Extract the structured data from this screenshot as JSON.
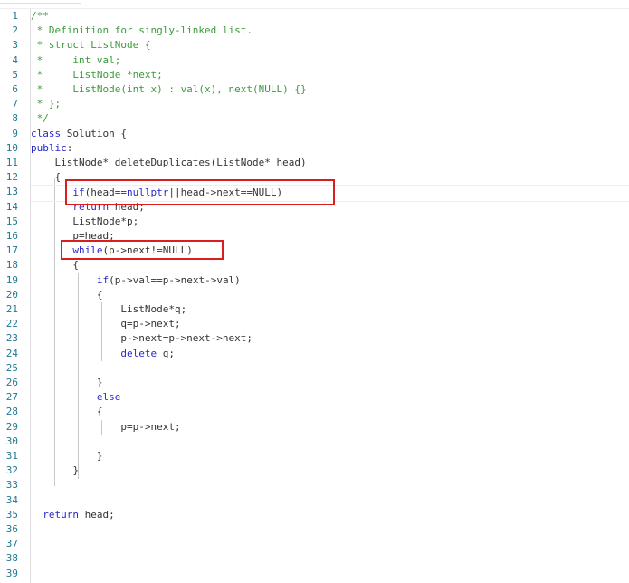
{
  "editor": {
    "current_line": 13,
    "colors": {
      "comment": "#3c9a3c",
      "keyword": "#2828c8",
      "text": "#333333",
      "line_number": "#237893",
      "highlight_box": "#d81e1e"
    },
    "highlighted_lines": [
      13,
      17
    ],
    "lines": [
      [
        [
          "/**",
          "c"
        ]
      ],
      [
        [
          " * Definition for singly-linked list.",
          "c"
        ]
      ],
      [
        [
          " * struct ListNode {",
          "c"
        ]
      ],
      [
        [
          " *     int val;",
          "c"
        ]
      ],
      [
        [
          " *     ListNode *next;",
          "c"
        ]
      ],
      [
        [
          " *     ListNode(int x) : val(x), next(NULL) {}",
          "c"
        ]
      ],
      [
        [
          " * };",
          "c"
        ]
      ],
      [
        [
          " */",
          "c"
        ]
      ],
      [
        [
          "class",
          "k"
        ],
        [
          " Solution {",
          "t"
        ]
      ],
      [
        [
          "public",
          "k"
        ],
        [
          ":",
          "t"
        ]
      ],
      [
        [
          "    ListNode* deleteDuplicates(ListNode* head)",
          "t"
        ]
      ],
      [
        [
          "    {",
          "t"
        ]
      ],
      [
        [
          "       ",
          "t"
        ],
        [
          "if",
          "k"
        ],
        [
          "(head==",
          "t"
        ],
        [
          "nullptr",
          "k"
        ],
        [
          "||head->next==NULL)",
          "t"
        ]
      ],
      [
        [
          "       ",
          "t"
        ],
        [
          "return",
          "k"
        ],
        [
          " head;",
          "t"
        ]
      ],
      [
        [
          "       ListNode*p;",
          "t"
        ]
      ],
      [
        [
          "       p=head;",
          "t"
        ]
      ],
      [
        [
          "       ",
          "t"
        ],
        [
          "while",
          "k"
        ],
        [
          "(p->next!=NULL)",
          "t"
        ]
      ],
      [
        [
          "       {",
          "t"
        ]
      ],
      [
        [
          "           ",
          "t"
        ],
        [
          "if",
          "k"
        ],
        [
          "(p->val==p->next->val)",
          "t"
        ]
      ],
      [
        [
          "           {",
          "t"
        ]
      ],
      [
        [
          "               ListNode*q;",
          "t"
        ]
      ],
      [
        [
          "               q=p->next;",
          "t"
        ]
      ],
      [
        [
          "               p->next=p->next->next;",
          "t"
        ]
      ],
      [
        [
          "               ",
          "t"
        ],
        [
          "delete",
          "k"
        ],
        [
          " q;",
          "t"
        ]
      ],
      [
        [
          "",
          "t"
        ]
      ],
      [
        [
          "           }",
          "t"
        ]
      ],
      [
        [
          "           ",
          "t"
        ],
        [
          "else",
          "k"
        ]
      ],
      [
        [
          "           {",
          "t"
        ]
      ],
      [
        [
          "               p=p->next;",
          "t"
        ]
      ],
      [
        [
          "",
          "t"
        ]
      ],
      [
        [
          "           }",
          "t"
        ]
      ],
      [
        [
          "       }",
          "t"
        ]
      ],
      [
        [
          "",
          "t"
        ]
      ],
      [
        [
          "",
          "t"
        ]
      ],
      [
        [
          "  ",
          "t"
        ],
        [
          "return",
          "k"
        ],
        [
          " head;",
          "t"
        ]
      ],
      [
        [
          "",
          "t"
        ]
      ],
      [
        [
          "",
          "t"
        ]
      ],
      [
        [
          "",
          "t"
        ]
      ],
      [
        [
          "",
          "t"
        ]
      ]
    ]
  }
}
